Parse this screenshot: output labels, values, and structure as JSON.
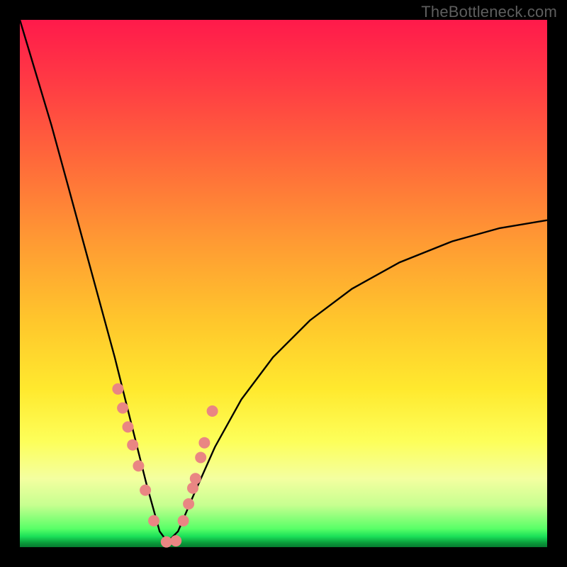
{
  "watermark": "TheBottleneck.com",
  "colors": {
    "frame": "#000000",
    "curve_stroke": "#000000",
    "dot_fill": "#e98683"
  },
  "chart_data": {
    "type": "line",
    "title": "",
    "xlabel": "",
    "ylabel": "",
    "xlim": [
      0,
      1
    ],
    "ylim": [
      0,
      1
    ],
    "grid": false,
    "curve": {
      "note": "V-shaped bottleneck curve. y≈1 at x=0, reaches y≈0 near x≈0.28, rises with diminishing slope toward y≈0.62 at x=1. All values normalized 0..1 where y=0 is bottom.",
      "x": [
        0.0,
        0.03,
        0.06,
        0.09,
        0.12,
        0.15,
        0.18,
        0.21,
        0.24,
        0.265,
        0.28,
        0.3,
        0.33,
        0.37,
        0.42,
        0.48,
        0.55,
        0.63,
        0.72,
        0.82,
        0.91,
        1.0
      ],
      "y": [
        1.0,
        0.9,
        0.8,
        0.69,
        0.58,
        0.47,
        0.36,
        0.24,
        0.12,
        0.03,
        0.01,
        0.03,
        0.1,
        0.19,
        0.28,
        0.36,
        0.43,
        0.49,
        0.54,
        0.58,
        0.605,
        0.62
      ]
    },
    "series": [
      {
        "name": "highlighted-points",
        "type": "scatter",
        "note": "pink dots overlaid along lower portion of the V",
        "x": [
          0.186,
          0.195,
          0.205,
          0.214,
          0.225,
          0.238,
          0.254,
          0.278,
          0.296,
          0.31,
          0.32,
          0.328,
          0.333,
          0.343,
          0.35,
          0.365
        ],
        "y": [
          0.3,
          0.264,
          0.228,
          0.194,
          0.154,
          0.108,
          0.05,
          0.01,
          0.012,
          0.05,
          0.082,
          0.112,
          0.13,
          0.17,
          0.198,
          0.258
        ]
      }
    ]
  }
}
